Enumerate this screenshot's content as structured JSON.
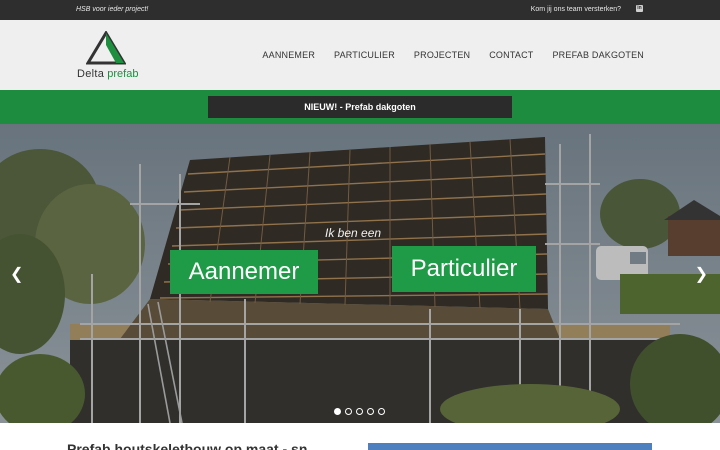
{
  "topbar": {
    "tagline": "HSB voor ieder project!",
    "recruit": "Kom jij ons team versterken?",
    "linkedin_icon": "linkedin-icon"
  },
  "logo": {
    "word1": "Delta",
    "word2": "prefab"
  },
  "nav": {
    "items": [
      {
        "label": "AANNEMER"
      },
      {
        "label": "PARTICULIER"
      },
      {
        "label": "PROJECTEN"
      },
      {
        "label": "CONTACT"
      },
      {
        "label": "PREFAB DAKGOTEN"
      }
    ]
  },
  "announcement": {
    "label": "NIEUW! - Prefab dakgoten"
  },
  "hero": {
    "intro": "Ik ben een",
    "cta_left": "Aannemer",
    "cta_right": "Particulier",
    "prev_icon": "chevron-left-icon",
    "next_icon": "chevron-right-icon",
    "slides_total": 5,
    "active_slide": 1
  },
  "content": {
    "heading": "Prefab houtskeletbouw op maat - snel"
  },
  "colors": {
    "brand_green": "#1d8c3f",
    "dark": "#2e2e2e",
    "cta_green": "#1f9a47"
  }
}
